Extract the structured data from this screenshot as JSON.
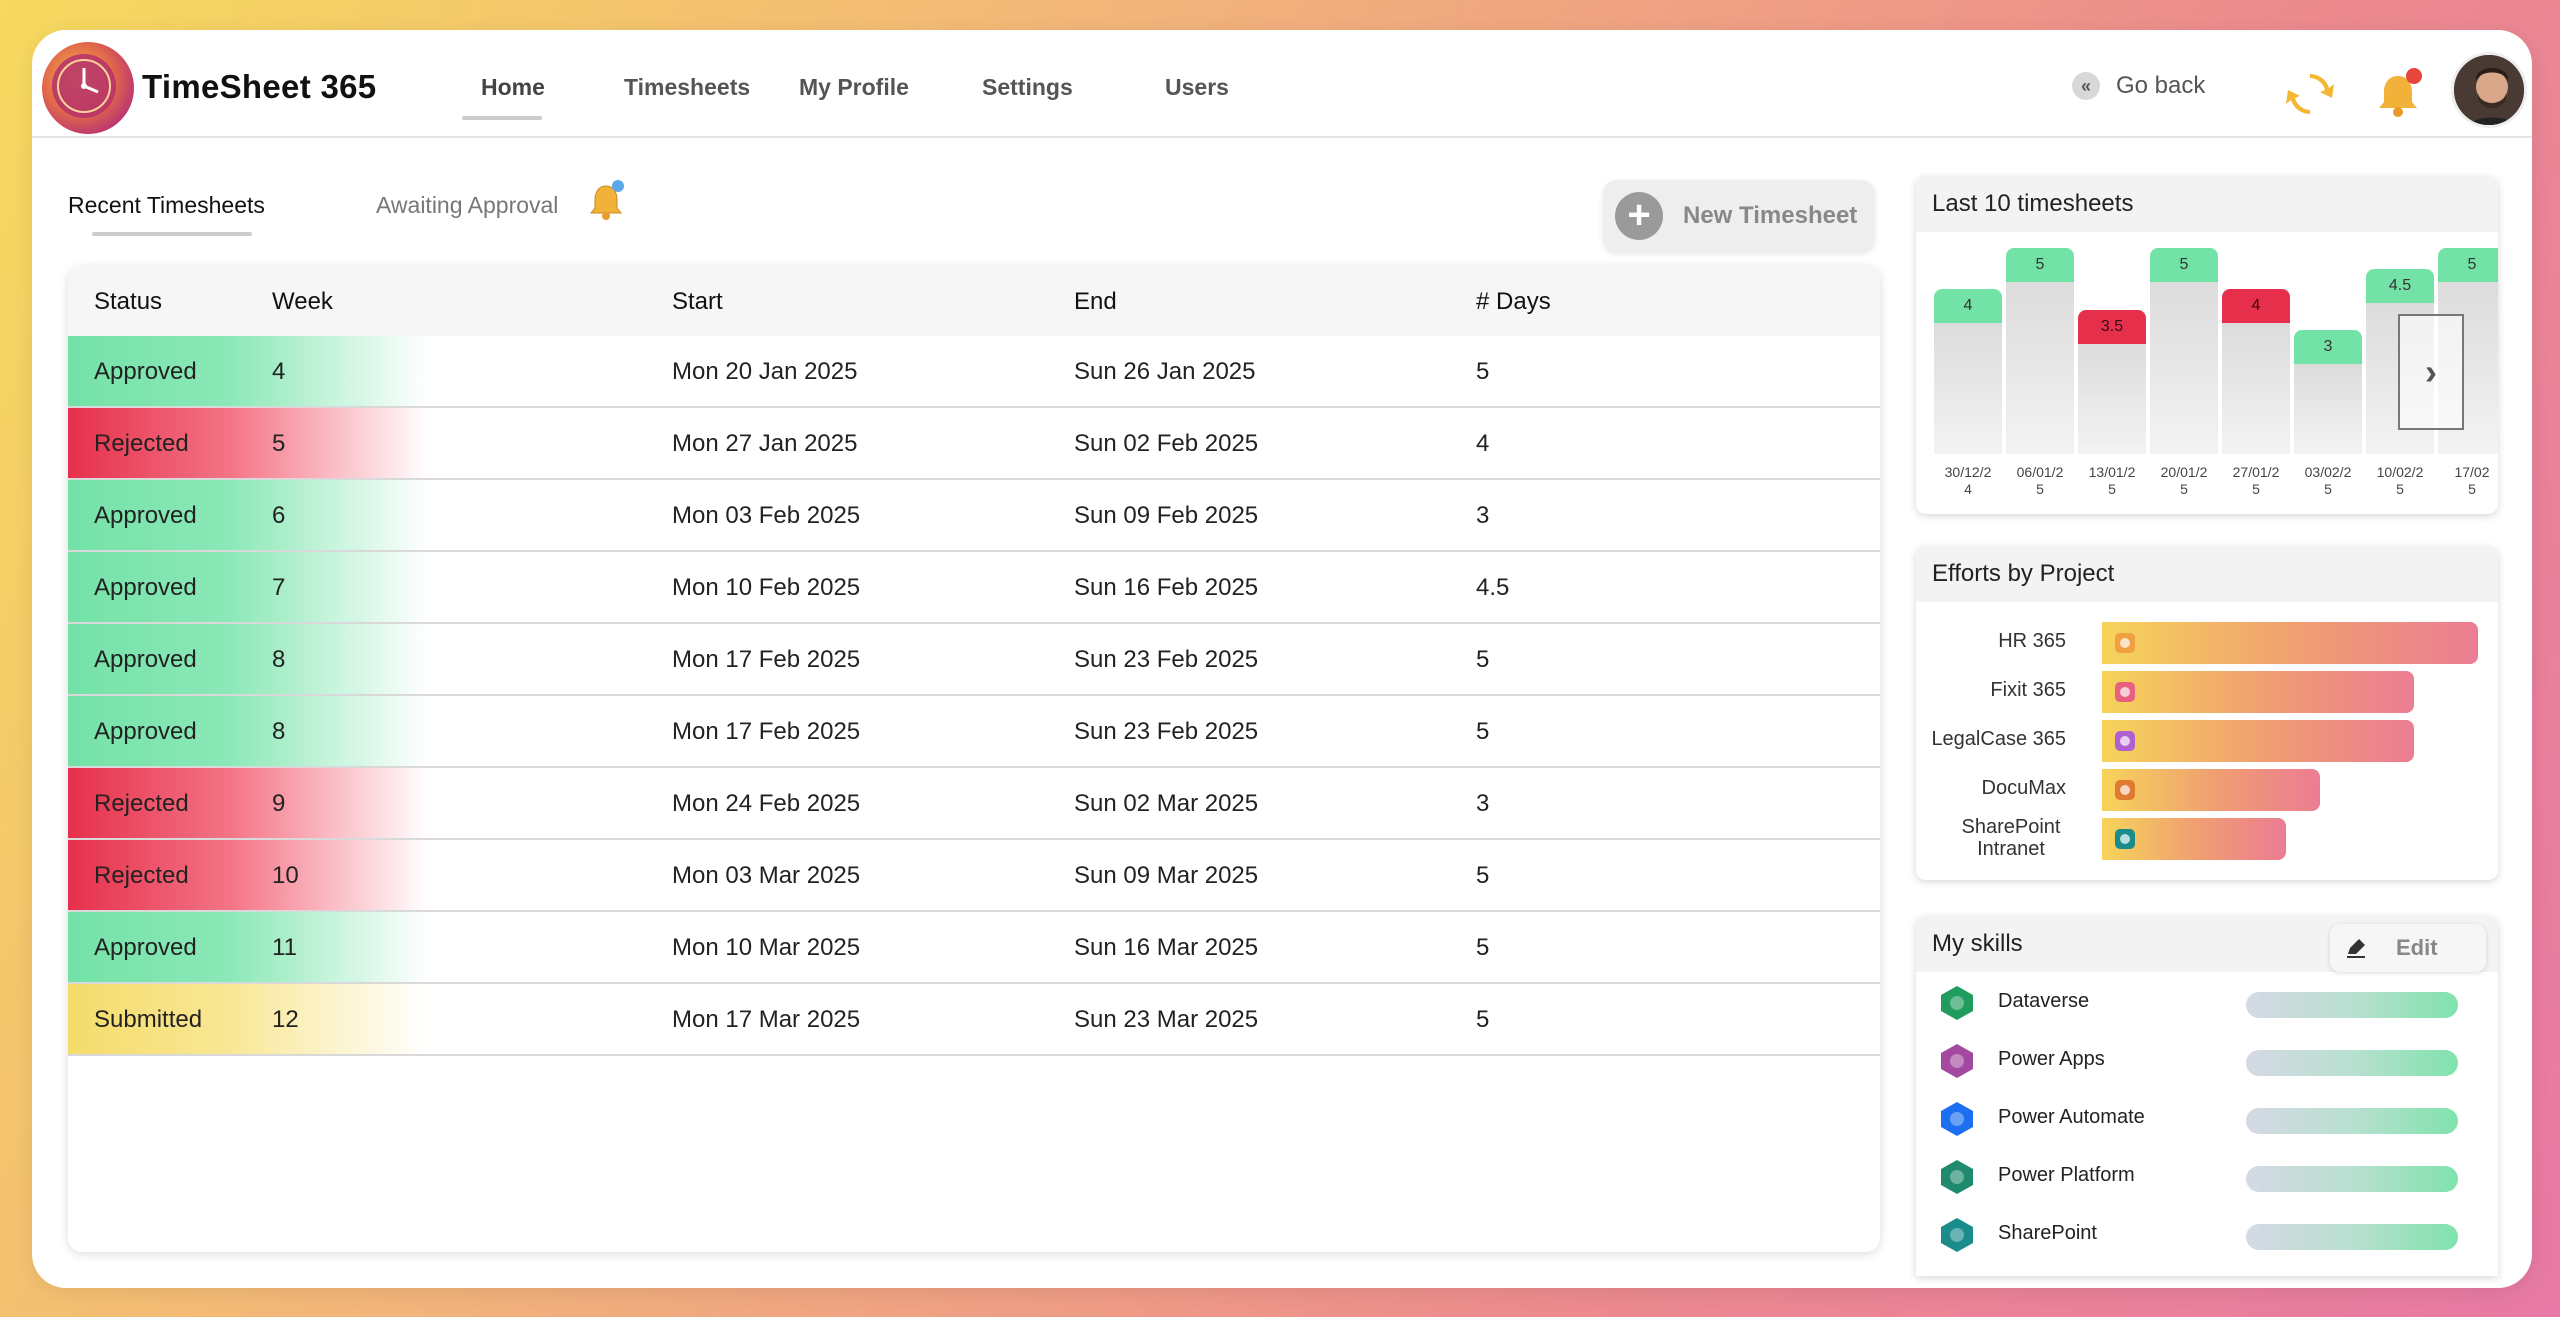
{
  "app": {
    "title": "TimeSheet 365"
  },
  "nav": {
    "items": [
      {
        "label": "Home"
      },
      {
        "label": "Timesheets"
      },
      {
        "label": "My Profile"
      },
      {
        "label": "Settings"
      },
      {
        "label": "Users"
      }
    ],
    "active": "Home",
    "go_back": "Go back"
  },
  "tabs": {
    "recent": "Recent Timesheets",
    "awaiting": "Awaiting Approval",
    "new_button": "New Timesheet"
  },
  "table": {
    "headers": [
      "Status",
      "Week",
      "Start",
      "End",
      "# Days"
    ],
    "rows": [
      {
        "status": "Approved",
        "week": "4",
        "start": "Mon 20 Jan 2025",
        "end": "Sun 26 Jan 2025",
        "days": "5"
      },
      {
        "status": "Rejected",
        "week": "5",
        "start": "Mon 27 Jan 2025",
        "end": "Sun 02 Feb 2025",
        "days": "4"
      },
      {
        "status": "Approved",
        "week": "6",
        "start": "Mon 03 Feb 2025",
        "end": "Sun 09 Feb 2025",
        "days": "3"
      },
      {
        "status": "Approved",
        "week": "7",
        "start": "Mon 10 Feb 2025",
        "end": "Sun 16 Feb 2025",
        "days": "4.5"
      },
      {
        "status": "Approved",
        "week": "8",
        "start": "Mon 17 Feb 2025",
        "end": "Sun 23 Feb 2025",
        "days": "5"
      },
      {
        "status": "Approved",
        "week": "8",
        "start": "Mon 17 Feb 2025",
        "end": "Sun 23 Feb 2025",
        "days": "5"
      },
      {
        "status": "Rejected",
        "week": "9",
        "start": "Mon 24 Feb 2025",
        "end": "Sun 02 Mar 2025",
        "days": "3"
      },
      {
        "status": "Rejected",
        "week": "10",
        "start": "Mon 03 Mar 2025",
        "end": "Sun 09 Mar 2025",
        "days": "5"
      },
      {
        "status": "Approved",
        "week": "11",
        "start": "Mon 10 Mar 2025",
        "end": "Sun 16 Mar 2025",
        "days": "5"
      },
      {
        "status": "Submitted",
        "week": "12",
        "start": "Mon 17 Mar 2025",
        "end": "Sun 23 Mar 2025",
        "days": "5"
      }
    ]
  },
  "last10": {
    "title": "Last 10 timesheets",
    "bars": [
      {
        "label": [
          "30/12/2",
          "4"
        ],
        "value": "4",
        "status": "approved"
      },
      {
        "label": [
          "06/01/2",
          "5"
        ],
        "value": "5",
        "status": "approved"
      },
      {
        "label": [
          "13/01/2",
          "5"
        ],
        "value": "3.5",
        "status": "rejected"
      },
      {
        "label": [
          "20/01/2",
          "5"
        ],
        "value": "5",
        "status": "approved"
      },
      {
        "label": [
          "27/01/2",
          "5"
        ],
        "value": "4",
        "status": "rejected"
      },
      {
        "label": [
          "03/02/2",
          "5"
        ],
        "value": "3",
        "status": "approved"
      },
      {
        "label": [
          "10/02/2",
          "5"
        ],
        "value": "4.5",
        "status": "approved"
      },
      {
        "label": [
          "17/02",
          "5"
        ],
        "value": "5",
        "status": "approved"
      }
    ],
    "colors": {
      "approved": "#73e2a7",
      "rejected": "#e6304b"
    }
  },
  "efforts": {
    "title": "Efforts by Project",
    "projects": [
      {
        "name": "HR 365",
        "value": 1.0,
        "icon": "hr-365-icon",
        "icon_color": "#f0a040"
      },
      {
        "name": "Fixit 365",
        "value": 0.83,
        "icon": "fixit-365-icon",
        "icon_color": "#e86080"
      },
      {
        "name": "LegalCase 365",
        "value": 0.83,
        "icon": "legalcase-365-icon",
        "icon_color": "#b060d0"
      },
      {
        "name": "DocuMax",
        "value": 0.58,
        "icon": "documax-icon",
        "icon_color": "#e07a30"
      },
      {
        "name": "SharePoint Intranet",
        "value": 0.49,
        "icon": "sharepoint-icon",
        "icon_color": "#1a8c8c"
      }
    ]
  },
  "skills": {
    "title": "My skills",
    "edit": "Edit",
    "items": [
      {
        "name": "Dataverse",
        "icon": "dataverse-icon",
        "color": "#1f9c5e"
      },
      {
        "name": "Power Apps",
        "icon": "power-apps-icon",
        "color": "#a34aa0"
      },
      {
        "name": "Power Automate",
        "icon": "power-automate-icon",
        "color": "#1c6ff0"
      },
      {
        "name": "Power Platform",
        "icon": "power-platform-icon",
        "color": "#1f8a6e"
      },
      {
        "name": "SharePoint",
        "icon": "sharepoint-icon",
        "color": "#1a8c8c"
      }
    ]
  }
}
